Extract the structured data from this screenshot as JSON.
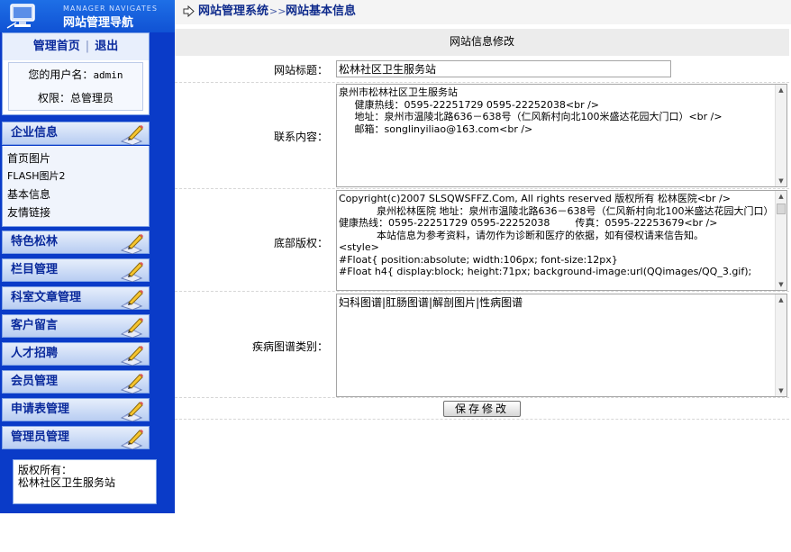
{
  "logo": {
    "subtitle": "MANAGER NAVIGATES",
    "title": "网站管理导航"
  },
  "user": {
    "home_link": "管理首页",
    "logout_link": "退出",
    "username_label": "您的用户名：",
    "username": "admin",
    "permission_label": "权限：",
    "permission": "总管理员"
  },
  "menu": [
    {
      "label": "企业信息",
      "expanded": true,
      "items": [
        "首页图片",
        "FLASH图片2",
        "基本信息",
        "友情链接"
      ]
    },
    {
      "label": "特色松林"
    },
    {
      "label": "栏目管理"
    },
    {
      "label": "科室文章管理"
    },
    {
      "label": "客户留言"
    },
    {
      "label": "人才招聘"
    },
    {
      "label": "会员管理"
    },
    {
      "label": "申请表管理"
    },
    {
      "label": "管理员管理"
    }
  ],
  "copyright_box": {
    "line1": "版权所有：",
    "line2": "松林社区卫生服务站"
  },
  "breadcrumb": {
    "root": "网站管理系统",
    "separator": ">>",
    "current": "网站基本信息"
  },
  "form": {
    "title": "网站信息修改",
    "site_title_label": "网站标题：",
    "site_title_value": "松林社区卫生服务站",
    "contact_label": "联系内容：",
    "contact_value": "泉州市松林社区卫生服务站\n     健康热线：0595-22251729 0595-22252038<br />\n     地址：泉州市温陵北路636－638号（仁风新村向北100米盛达花园大门口）<br />\n     邮箱：songlinyiliao@163.com<br />",
    "footer_label": "底部版权：",
    "footer_value": "Copyright(c)2007 SLSQWSFFZ.Com, All rights reserved 版权所有 松林医院<br />\n            泉州松林医院 地址：泉州市温陵北路636－638号（仁风新村向北100米盛达花园大门口）        健康热线：0595-22251729 0595-22252038        传真：0595-22253679<br />\n            本站信息为参考资料，请勿作为诊断和医疗的依据，如有侵权请来信告知。\n<style>\n#Float{ position:absolute; width:106px; font-size:12px}\n#Float h4{ display:block; height:71px; background-image:url(QQimages/QQ_3.gif);",
    "disease_label": "疾病图谱类别：",
    "disease_value": "妇科图谱|肛肠图谱|解剖图片|性病图谱",
    "save_button": "保存修改"
  }
}
